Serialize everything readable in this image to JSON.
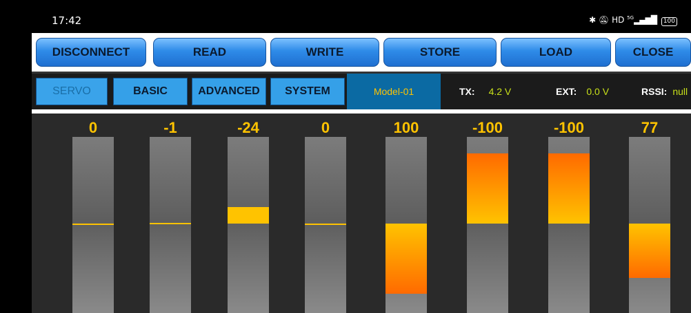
{
  "status_bar": {
    "time": "17:42",
    "icons": [
      "bluetooth-icon",
      "mute-icon",
      "hd-icon",
      "5g-signal-icon",
      "battery-icon"
    ],
    "hd": "HD",
    "network": "5G",
    "battery": "100"
  },
  "toolbar": {
    "disconnect": "DISCONNECT",
    "read": "READ",
    "write": "WRITE",
    "store": "STORE",
    "load": "LOAD",
    "close": "CLOSE"
  },
  "tabs": {
    "servo": "SERVO",
    "basic": "BASIC",
    "advanced": "ADVANCED",
    "system": "SYSTEM"
  },
  "model_name": "Model-01",
  "telemetry": {
    "tx_label": "TX:",
    "tx_value": "4.2 V",
    "ext_label": "EXT:",
    "ext_value": "0.0 V",
    "rssi_label": "RSSI:",
    "rssi_value": "null"
  },
  "channels": [
    {
      "value": "0",
      "level": 0
    },
    {
      "value": "-1",
      "level": -1
    },
    {
      "value": "-24",
      "level": -24
    },
    {
      "value": "0",
      "level": 0
    },
    {
      "value": "100",
      "level": 100
    },
    {
      "value": "-100",
      "level": -100
    },
    {
      "value": "-100",
      "level": -100
    },
    {
      "value": "77",
      "level": 77
    }
  ],
  "colors": {
    "accent_yellow": "#ffc300",
    "fill_orange": "#ff6a00",
    "button_blue": "#2e8be8",
    "model_bg": "#0b6aa3"
  }
}
